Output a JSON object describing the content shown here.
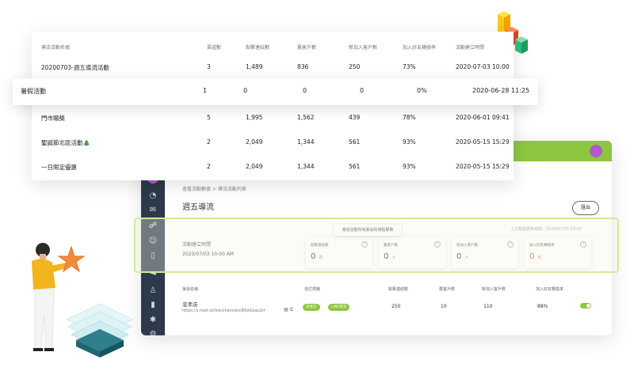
{
  "table": {
    "headers": [
      "導流活動名稱",
      "渠道數",
      "點擊連結數",
      "舊客戶數",
      "新加入客戶數",
      "加入好友轉換率",
      "活動建立時間"
    ],
    "rows": [
      {
        "name": "20200703-週五導流活動",
        "channels": "3",
        "clicks": "1,489",
        "old": "836",
        "new": "250",
        "rate": "73%",
        "created": "2020-07-03 10:00"
      },
      {
        "name": "暑假活動",
        "channels": "1",
        "clicks": "0",
        "old": "0",
        "new": "0",
        "rate": "0%",
        "created": "2020-06-28 11:25"
      },
      {
        "name": "門市贈獎",
        "channels": "5",
        "clicks": "1,995",
        "old": "1,562",
        "new": "439",
        "rate": "78%",
        "created": "2020-06-01 09:41"
      },
      {
        "name": "聖誕節北區活動🎄",
        "channels": "2",
        "clicks": "2,049",
        "old": "1,344",
        "new": "561",
        "rate": "93%",
        "created": "2020-05-15 15:29"
      },
      {
        "name": "一日限定優惠",
        "channels": "2",
        "clicks": "2,049",
        "old": "1,344",
        "new": "561",
        "rate": "93%",
        "created": "2020-05-15 15:29"
      }
    ]
  },
  "dashboard": {
    "breadcrumb": "查看活動數據  >  導流活動列表",
    "title": "週五導流",
    "export_label": "匯出",
    "update_time": "上次數據更新時間：2020/07/03 10:00",
    "tooltip": "導流活動所有渠道的總點擊數",
    "created_label": "活動建立時間",
    "created_value": "2020/07/03 10:00 AM",
    "stats": [
      {
        "label": "點擊連結數",
        "value": "0",
        "unit": "次"
      },
      {
        "label": "舊客戶數",
        "value": "0",
        "unit": "人"
      },
      {
        "label": "新加入客戶數",
        "value": "0",
        "unit": "人"
      },
      {
        "label": "加入好友轉換率",
        "value": "0",
        "unit": "%"
      }
    ],
    "channel_headers": [
      "渠道名稱",
      "自訂標籤",
      "點擊連結數",
      "舊客戶數",
      "新加入客戶數",
      "加入好友轉換率"
    ],
    "channel_row": {
      "name": "忠孝店",
      "url": "https://s.rosil.io/link/channels/B5eGxaLGrr",
      "tags": [
        "忠孝店",
        "LINE導流"
      ],
      "clicks": "250",
      "old": "10",
      "new": "110",
      "rate": "88%"
    }
  },
  "colors": {
    "accent": "#8dc63f",
    "sidebar": "#2d3a4b",
    "highlight": "#d6e89d",
    "negative": "#e64a3b"
  }
}
